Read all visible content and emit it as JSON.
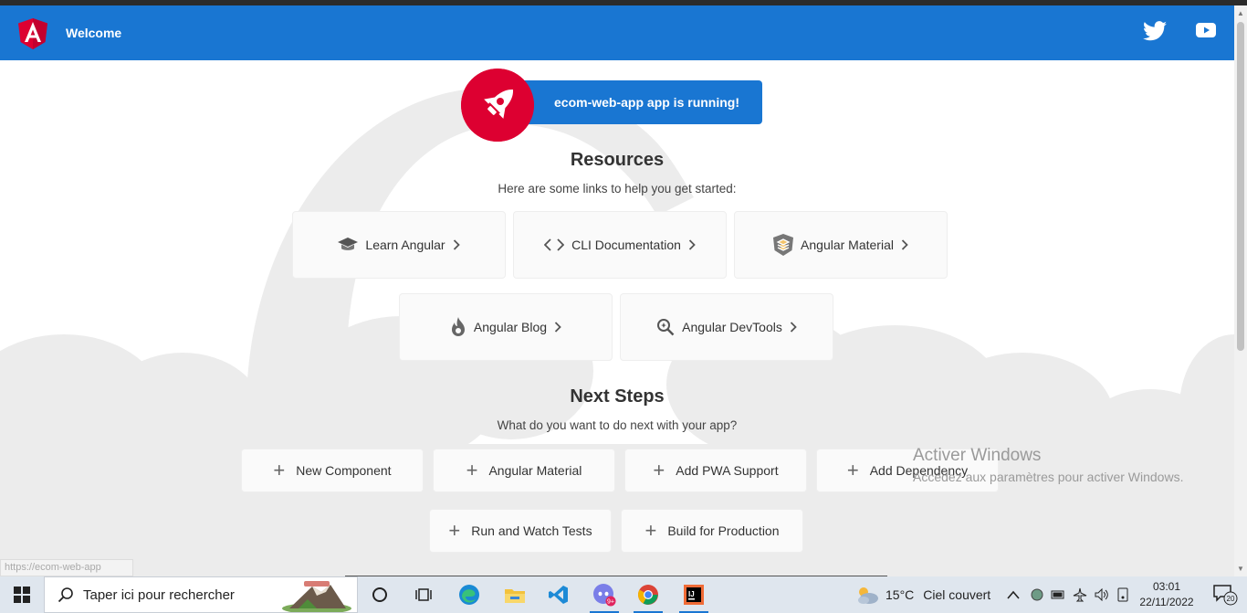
{
  "toolbar": {
    "title": "Welcome",
    "logo_icon": "angular-logo-icon",
    "social": [
      "twitter-icon",
      "youtube-icon"
    ],
    "color": "#1976d2"
  },
  "running_card": {
    "text": "ecom-web-app app is running!",
    "icon": "rocket-icon",
    "rocket_color": "#dd0031"
  },
  "resources": {
    "heading": "Resources",
    "subheading": "Here are some links to help you get started:",
    "links": [
      {
        "label": "Learn Angular",
        "icon": "graduation-cap-icon"
      },
      {
        "label": "CLI Documentation",
        "icon": "code-brackets-icon"
      },
      {
        "label": "Angular Material",
        "icon": "angular-material-icon"
      },
      {
        "label": "Angular Blog",
        "icon": "flame-icon"
      },
      {
        "label": "Angular DevTools",
        "icon": "devtools-search-icon"
      }
    ]
  },
  "next_steps": {
    "heading": "Next Steps",
    "subheading": "What do you want to do next with your app?",
    "steps": [
      "New Component",
      "Angular Material",
      "Add PWA Support",
      "Add Dependency",
      "Run and Watch Tests",
      "Build for Production"
    ]
  },
  "watermark": {
    "line1": "Activer Windows",
    "line2": "Accédez aux paramètres pour activer Windows."
  },
  "status_url": "https://ecom-web-app",
  "taskbar": {
    "search_placeholder": "Taper ici pour rechercher",
    "apps": [
      "cortana-icon",
      "task-view-icon",
      "edge-icon",
      "file-explorer-icon",
      "vscode-icon",
      "discord-icon",
      "chrome-icon",
      "intellij-icon"
    ],
    "discord_badge": "9+",
    "weather_temp": "15°C",
    "weather_text": "Ciel couvert",
    "time": "03:01",
    "date": "22/11/2022",
    "notification_count": "20"
  }
}
